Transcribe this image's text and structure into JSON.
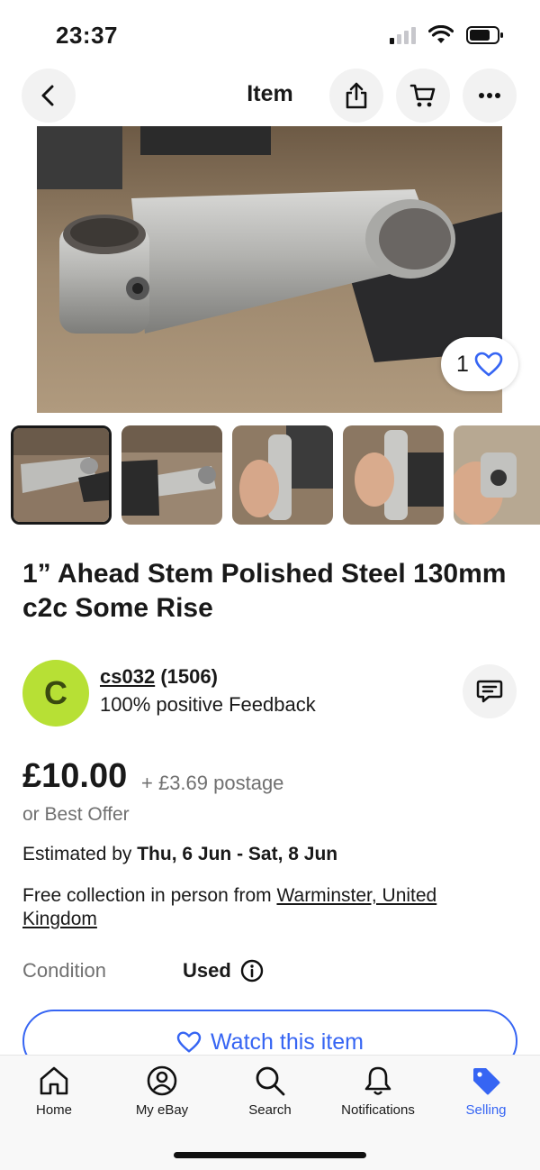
{
  "status_bar": {
    "time": "23:37"
  },
  "header": {
    "title": "Item"
  },
  "hero": {
    "watch_count": "1",
    "image_alt": "Polished steel bike stem on wooden table"
  },
  "thumbnails": [
    {
      "selected": true
    },
    {
      "selected": false
    },
    {
      "selected": false
    },
    {
      "selected": false
    },
    {
      "selected": false
    }
  ],
  "item": {
    "title": "1” Ahead Stem Polished Steel 130mm c2c Some Rise",
    "price": "£10.00",
    "postage": "+ £3.69 postage",
    "best_offer": "or Best Offer",
    "estimated_prefix": "Estimated by ",
    "estimated_dates": "Thu, 6 Jun - Sat, 8 Jun",
    "collection_prefix": "Free collection in person from ",
    "collection_location": "Warminster, United Kingdom",
    "condition_label": "Condition",
    "condition_value": "Used"
  },
  "seller": {
    "initial": "C",
    "name": "cs032",
    "score": "(1506)",
    "feedback": "100% positive Feedback"
  },
  "actions": {
    "watch_label": "Watch this item"
  },
  "bottom_nav": [
    {
      "label": "Home",
      "icon": "home-icon"
    },
    {
      "label": "My eBay",
      "icon": "user-icon"
    },
    {
      "label": "Search",
      "icon": "search-icon"
    },
    {
      "label": "Notifications",
      "icon": "bell-icon"
    },
    {
      "label": "Selling",
      "icon": "tag-icon",
      "active": true
    }
  ],
  "colors": {
    "accent": "#3665f3",
    "avatar": "#b7e035",
    "text": "#191919",
    "muted": "#707070"
  }
}
